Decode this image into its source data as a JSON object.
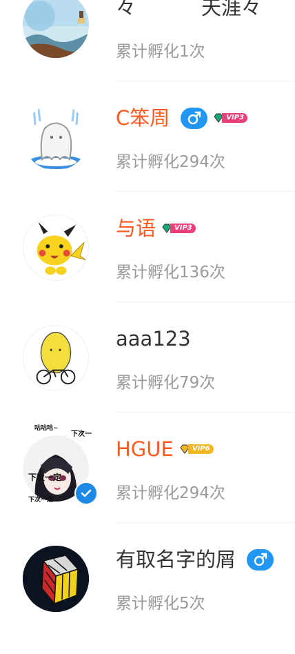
{
  "colors": {
    "highlight_name": "#ff5a1f",
    "normal_name": "#333333",
    "meta": "#9a9a9a",
    "male_badge": "#2196f3",
    "vip_pink": "#ec3f7a",
    "vip_gold": "#f2b622"
  },
  "users": [
    {
      "name_left": "々",
      "name_right": "天涯々",
      "hatch_count": "累计孵化1次",
      "avatar": "landscape-painting"
    },
    {
      "name": "C笨周",
      "hatch_count": "累计孵化294次",
      "male": "♂",
      "vip": "VIP3",
      "avatar": "ghost"
    },
    {
      "name": "与语",
      "hatch_count": "累计孵化136次",
      "vip": "VIP3",
      "avatar": "pikachu"
    },
    {
      "name": "aaa123",
      "hatch_count": "累计孵化79次",
      "avatar": "lemon-on-bike"
    },
    {
      "name": "HGUE",
      "hatch_count": "累计孵化294次",
      "vip": "VIP6",
      "avatar": "anime-girl",
      "avatar_texts": [
        "咕咕咕~",
        "下次一",
        "下次一定",
        "下次一定"
      ]
    },
    {
      "name": "有取名字的屑",
      "hatch_count": "累计孵化5次",
      "male": "♂",
      "avatar": "rubiks-cube"
    }
  ]
}
